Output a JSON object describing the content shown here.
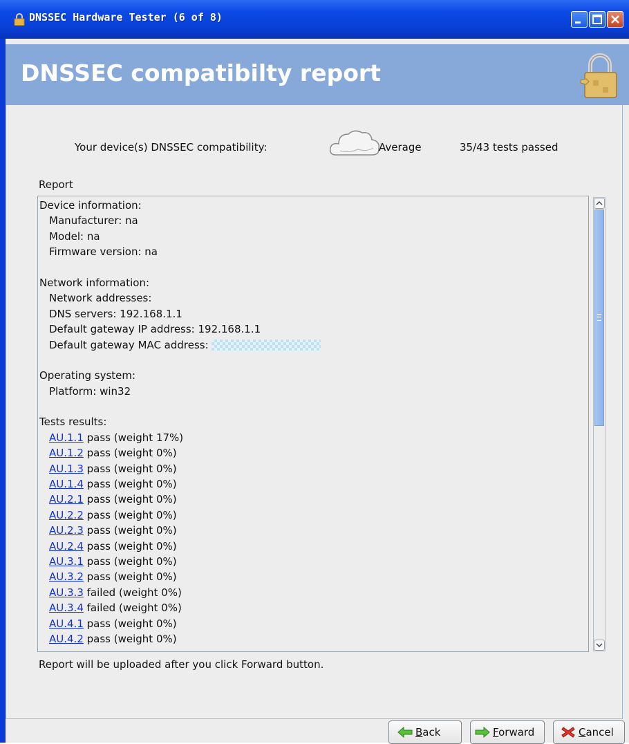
{
  "window": {
    "title": "DNSSEC Hardware Tester (6 of 8)"
  },
  "header": {
    "title": "DNSSEC compatibilty report"
  },
  "compat": {
    "label": "Your device(s) DNSSEC compatibility:",
    "rating": "Average",
    "tests": "35/43 tests passed"
  },
  "report": {
    "label": "Report",
    "device_heading": "Device information:",
    "manufacturer": "Manufacturer: na",
    "model": "Model: na",
    "firmware": "Firmware version: na",
    "network_heading": "Network information:",
    "network_addresses": "Network addresses:",
    "dns_servers": "DNS servers: 192.168.1.1",
    "gateway_ip": "Default gateway IP address: 192.168.1.1",
    "gateway_mac": "Default gateway MAC address: ",
    "os_heading": "Operating system:",
    "platform": "Platform: win32",
    "tests_heading": "Tests results:",
    "tests": [
      {
        "id": "AU.1.1",
        "result": " pass (weight 17%)"
      },
      {
        "id": "AU.1.2",
        "result": " pass (weight 0%)"
      },
      {
        "id": "AU.1.3",
        "result": " pass (weight 0%)"
      },
      {
        "id": "AU.1.4",
        "result": " pass (weight 0%)"
      },
      {
        "id": "AU.2.1",
        "result": " pass (weight 0%)"
      },
      {
        "id": "AU.2.2",
        "result": " pass (weight 0%)"
      },
      {
        "id": "AU.2.3",
        "result": " pass (weight 0%)"
      },
      {
        "id": "AU.2.4",
        "result": " pass (weight 0%)"
      },
      {
        "id": "AU.3.1",
        "result": " pass (weight 0%)"
      },
      {
        "id": "AU.3.2",
        "result": " pass (weight 0%)"
      },
      {
        "id": "AU.3.3",
        "result": " failed (weight 0%)"
      },
      {
        "id": "AU.3.4",
        "result": " failed (weight 0%)"
      },
      {
        "id": "AU.4.1",
        "result": " pass (weight 0%)"
      },
      {
        "id": "AU.4.2",
        "result": " pass (weight 0%)"
      }
    ]
  },
  "footer_note": "Report will be uploaded after you click Forward button.",
  "buttons": {
    "back_accel": "B",
    "back_rest": "ack",
    "forward_accel": "F",
    "forward_rest": "orward",
    "cancel_accel": "C",
    "cancel_rest": "ancel"
  },
  "icons": {
    "title": "lock-icon",
    "header": "puzzle-lock-icon",
    "rating": "cloud-icon",
    "back": "arrow-left-icon",
    "forward": "arrow-right-icon",
    "cancel": "red-x-icon"
  },
  "colors": {
    "titlebar": "#0841d8",
    "header": "#87a9d9",
    "link": "#1530d8"
  }
}
